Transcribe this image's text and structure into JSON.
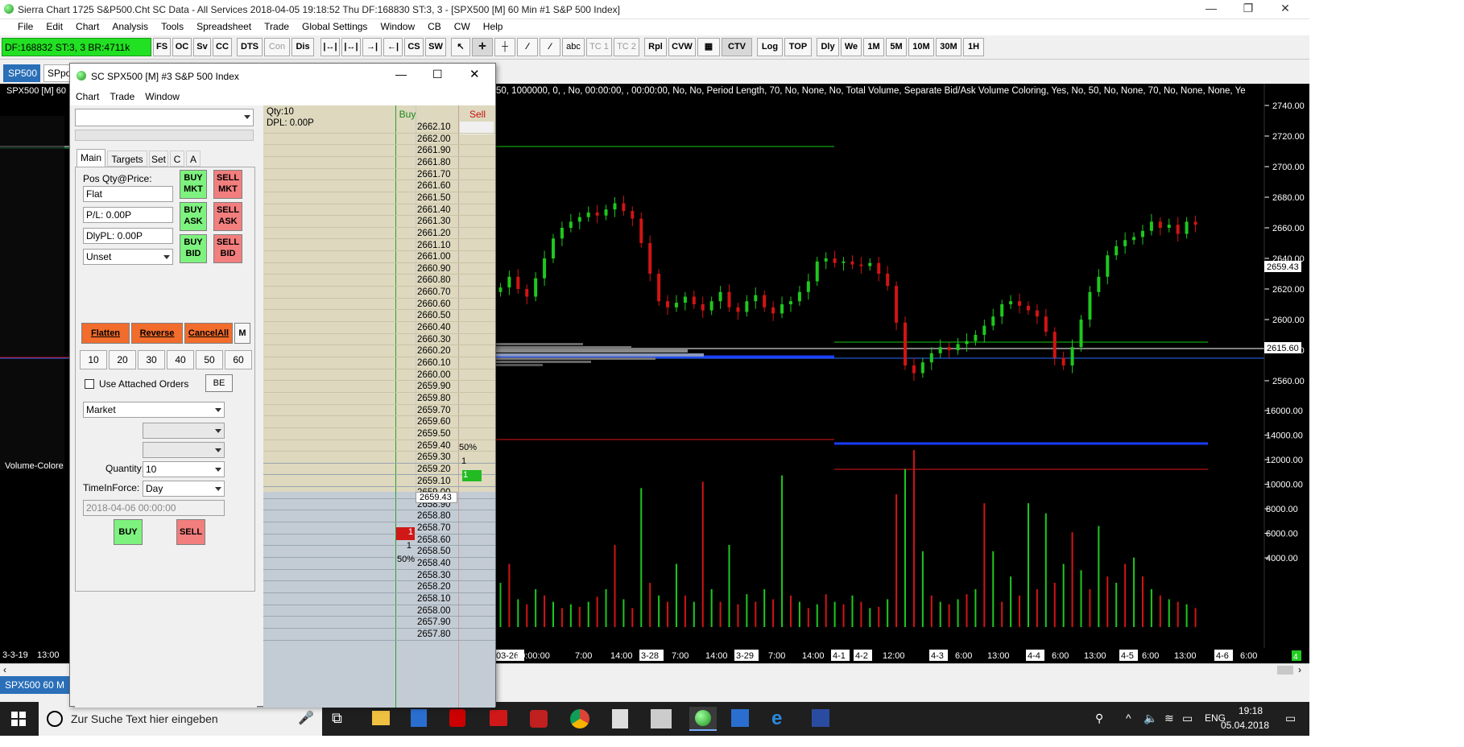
{
  "window": {
    "title": "Sierra Chart 1725 S&P500.Cht  SC Data - All Services 2018-04-05  19:18:52 Thu  DF:168830  ST:3, 3 - [SPX500 [M]  60 Min  #1  S&P 500 Index]",
    "controls": [
      "—",
      "❐",
      "✕"
    ]
  },
  "menu": [
    "File",
    "Edit",
    "Chart",
    "Analysis",
    "Tools",
    "Spreadsheet",
    "Trade",
    "Global Settings",
    "Window",
    "CB",
    "CW",
    "Help"
  ],
  "toolbar": {
    "status": "DF:168832  ST:3, 3  BR:4711k",
    "buttons": [
      "FS",
      "OC",
      "Sv",
      "CC",
      "DTS",
      "Con",
      "Dis"
    ],
    "tools": [
      "abc",
      "TC 1",
      "TC 2",
      "Rpl",
      "CVW",
      "CTV",
      "Log",
      "TOP",
      "Dly",
      "We",
      "1M",
      "5M",
      "10M",
      "30M",
      "1H"
    ]
  },
  "chart_tabs": [
    "SP500",
    "SPpo"
  ],
  "chart": {
    "header": "SPX500 [M]  60",
    "study_text": "50, 1000000, 0, , No, 00:00:00, , 00:00:00, No, No, Period Length, 70, No, None, No, Total Volume, Separate Bid/Ask Volume Coloring, Yes, No, 50, No, None, 70, No, None, None, Ye",
    "side_label": "Volume-Colore",
    "last_price": "2659.43",
    "cursor_price": "2615.60",
    "small_tag": "4",
    "x_left": [
      "3-3-19",
      "13:00"
    ]
  },
  "chart_data": {
    "type": "candlestick",
    "price_axis": [
      "2740.00",
      "2720.00",
      "2700.00",
      "2680.00",
      "2660.00",
      "2640.00",
      "2620.00",
      "2600.00",
      "2580.00",
      "2560.00"
    ],
    "volume_axis": [
      "16000.00",
      "14000.00",
      "12000.00",
      "10000.00",
      "8000.00",
      "6000.00",
      "4000.00"
    ],
    "x_ticks": [
      "03-26",
      "10:00:00",
      "7:00",
      "14:00",
      "3-28",
      "7:00",
      "14:00",
      "3-29",
      "7:00",
      "14:00",
      "4-1",
      "4-2",
      "12:00",
      "4-3",
      "6:00",
      "13:00",
      "4-4",
      "6:00",
      "13:00",
      "4-5",
      "6:00",
      "13:00",
      "4-6",
      "6:00"
    ],
    "price_range": [
      2548,
      2750
    ],
    "volume_range": [
      0,
      17200
    ],
    "closes": [
      2621,
      2628,
      2620,
      2615,
      2627,
      2640,
      2653,
      2660,
      2664,
      2667,
      2670,
      2668,
      2672,
      2676,
      2671,
      2666,
      2650,
      2630,
      2612,
      2608,
      2611,
      2615,
      2610,
      2606,
      2612,
      2618,
      2608,
      2605,
      2612,
      2616,
      2608,
      2604,
      2610,
      2612,
      2618,
      2625,
      2638,
      2640,
      2637,
      2638,
      2636,
      2635,
      2637,
      2630,
      2622,
      2598,
      2570,
      2565,
      2572,
      2578,
      2582,
      2580,
      2584,
      2586,
      2590,
      2596,
      2602,
      2610,
      2612,
      2609,
      2606,
      2602,
      2592,
      2575,
      2570,
      2582,
      2600,
      2618,
      2628,
      2642,
      2648,
      2652,
      2654,
      2658,
      2664,
      2660,
      2662,
      2656,
      2664,
      2662
    ],
    "volumes": [
      3500,
      5000,
      2200,
      1800,
      3000,
      2500,
      2000,
      1500,
      1800,
      1600,
      2000,
      2400,
      3000,
      6500,
      2200,
      1500,
      11000,
      3500,
      2500,
      2000,
      5000,
      2500,
      2000,
      11500,
      3000,
      2000,
      6500,
      1800,
      2600,
      2000,
      3000,
      2200,
      12000,
      2500,
      2000,
      1500,
      1800,
      2600,
      2000,
      1800,
      2500,
      2000,
      1500,
      1600,
      2200,
      10500,
      12500,
      14000,
      6000,
      2500,
      2000,
      1800,
      2200,
      2600,
      3000,
      9800,
      6000,
      2000,
      4000,
      2500,
      9800,
      3000,
      9000,
      3500,
      5000,
      7500,
      4500,
      3000,
      8000,
      4000,
      3500,
      5000,
      5500,
      4000,
      3000,
      2500,
      2200,
      2000,
      1800,
      1500
    ]
  },
  "dom": {
    "title": "SC SPX500 [M]  #3  S&P 500 Index",
    "menu": [
      "Chart",
      "Trade",
      "Window"
    ],
    "tabs": [
      "Main",
      "Targets",
      "Set",
      "C",
      "A"
    ],
    "pos_label": "Pos Qty@Price:",
    "pos_value": "Flat",
    "pl_value": "P/L: 0.00P",
    "dly_value": "DlyPL: 0.00P",
    "unset": "Unset",
    "buy_mkt": "BUY MKT",
    "sell_mkt": "SELL MKT",
    "buy_ask": "BUY ASK",
    "sell_ask": "SELL ASK",
    "buy_bid": "BUY BID",
    "sell_bid": "SELL BID",
    "flatten": "Flatten",
    "reverse": "Reverse",
    "cancel_all": "CancelAll",
    "m": "M",
    "quantities": [
      "10",
      "20",
      "30",
      "40",
      "50",
      "60"
    ],
    "use_attached": "Use Attached Orders",
    "be": "BE",
    "order_type": "Market",
    "quantity_label": "Quantity:",
    "quantity_value": "10",
    "tif_label": "TimeInForce:",
    "tif_value": "Day",
    "date_value": "2018-04-06  00:00:00",
    "buy": "BUY",
    "sell": "SELL",
    "qty_info": "Qty:10",
    "dpl_info": "DPL: 0.00P",
    "buy_header": "Buy",
    "sell_header": "Sell",
    "last_price": "2659.43",
    "prices": [
      "2662.10",
      "2662.00",
      "2661.90",
      "2661.80",
      "2661.70",
      "2661.60",
      "2661.50",
      "2661.40",
      "2661.30",
      "2661.20",
      "2661.10",
      "2661.00",
      "2660.90",
      "2660.80",
      "2660.70",
      "2660.60",
      "2660.50",
      "2660.40",
      "2660.30",
      "2660.20",
      "2660.10",
      "2660.00",
      "2659.90",
      "2659.80",
      "2659.70",
      "2659.60",
      "2659.50",
      "2659.40",
      "2659.30",
      "2659.20",
      "2659.10",
      "2659.00",
      "2658.90",
      "2658.80",
      "2658.70",
      "2658.60",
      "2658.50",
      "2658.40",
      "2658.30",
      "2658.20",
      "2658.10",
      "2658.00",
      "2657.90",
      "2657.80"
    ],
    "sell_side": [
      "50%",
      "1",
      "1"
    ],
    "buy_side": [
      "1",
      "1",
      "50%"
    ]
  },
  "bottom_tab": "SPX500  60 M",
  "taskbar": {
    "search_placeholder": "Zur Suche Text hier eingeben",
    "lang": "ENG",
    "time": "19:18",
    "date": "05.04.2018"
  }
}
